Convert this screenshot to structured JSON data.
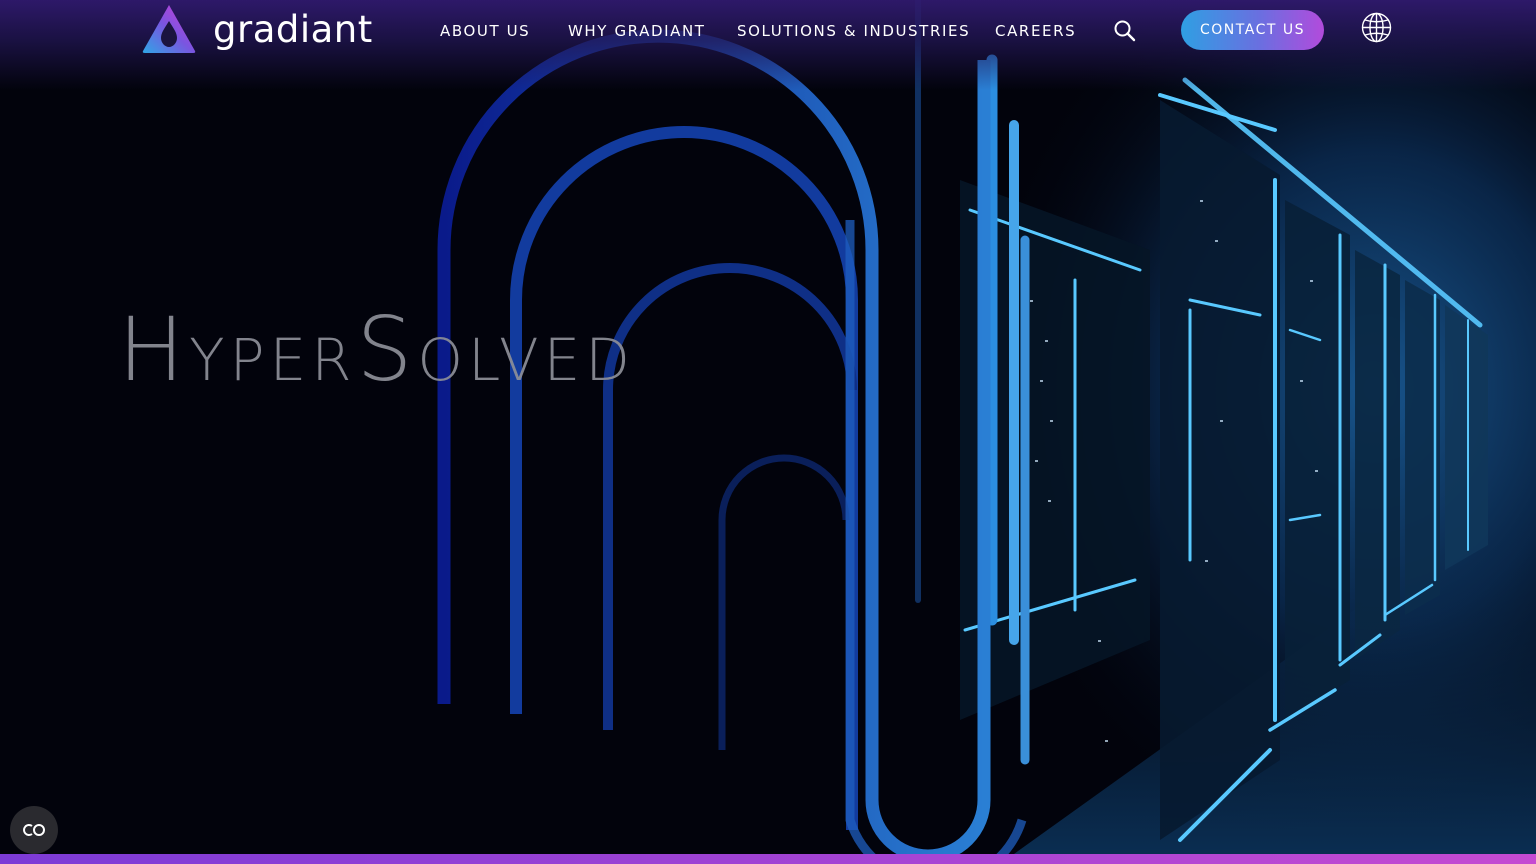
{
  "brand": {
    "name": "gradiant",
    "gradient_colors": [
      "#2fa6e6",
      "#7a55e0",
      "#d43ad6"
    ]
  },
  "nav": {
    "items": [
      {
        "label": "ABOUT US"
      },
      {
        "label": "WHY GRADIANT"
      },
      {
        "label": "SOLUTIONS & INDUSTRIES"
      },
      {
        "label": "CAREERS"
      }
    ],
    "search_icon": "search-icon",
    "contact_label": "CONTACT US",
    "language_icon": "globe-icon"
  },
  "hero": {
    "headline_parts": [
      "H",
      "YPER",
      "S",
      "OLVED"
    ],
    "background": "data-center-corridor",
    "accent_color": "#1e6fd9"
  },
  "footer_widget": {
    "cookie_icon": "cookie-preferences-icon"
  }
}
